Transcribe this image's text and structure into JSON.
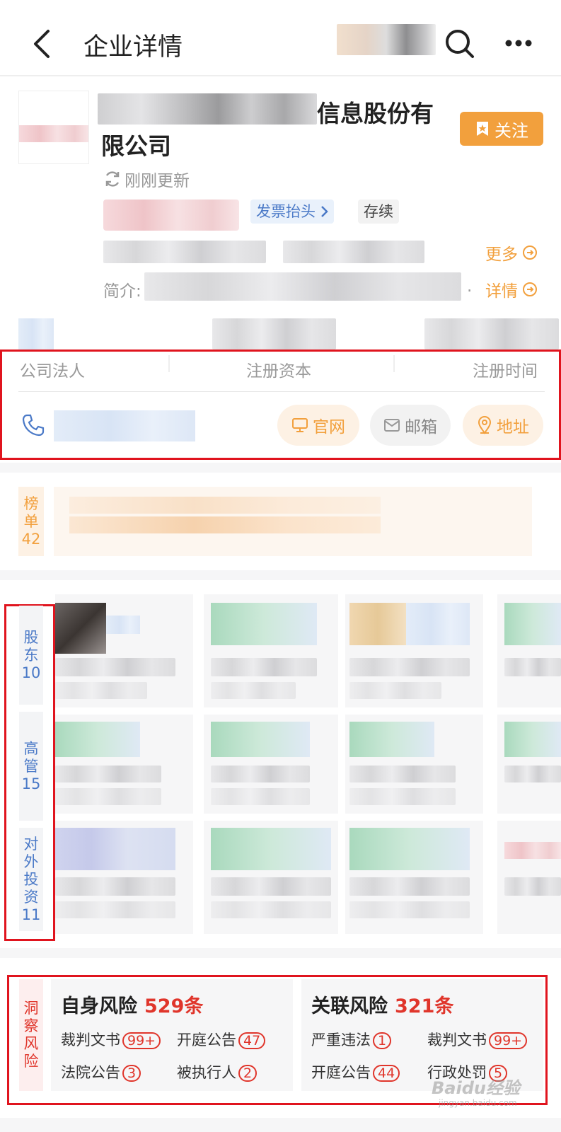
{
  "header": {
    "title": "企业详情"
  },
  "company": {
    "name_suffix": "信息股份有",
    "name_line2": "限公司",
    "follow_label": "关注",
    "updated": "刚刚更新",
    "invoice_label": "发票抬头",
    "status": "存续",
    "more_label": "更多",
    "intro_label": "简介:",
    "intro_end": ".",
    "detail_label": "详情"
  },
  "info": {
    "legal_person": "公司法人",
    "capital": "注册资本",
    "reg_time": "注册时间",
    "website": "官网",
    "email": "邮箱",
    "address": "地址"
  },
  "ranking": {
    "label_1": "榜",
    "label_2": "单",
    "count": "42"
  },
  "tabs": [
    {
      "l1": "股",
      "l2": "东",
      "count": "10"
    },
    {
      "l1": "高",
      "l2": "管",
      "count": "15"
    },
    {
      "l1": "对",
      "l2": "外",
      "l3": "投",
      "l4": "资",
      "count": "11"
    }
  ],
  "risk": {
    "label": [
      "洞",
      "察",
      "风",
      "险"
    ],
    "self": {
      "title": "自身风险",
      "count": "529条",
      "items": [
        {
          "name": "裁判文书",
          "num": "99+"
        },
        {
          "name": "开庭公告",
          "num": "47"
        },
        {
          "name": "法院公告",
          "num": "3"
        },
        {
          "name": "被执行人",
          "num": "2"
        }
      ]
    },
    "related": {
      "title": "关联风险",
      "count": "321条",
      "items": [
        {
          "name": "严重违法",
          "num": "1"
        },
        {
          "name": "裁判文书",
          "num": "99+"
        },
        {
          "name": "开庭公告",
          "num": "44"
        },
        {
          "name": "行政处罚",
          "num": "5"
        }
      ]
    }
  },
  "watermark": {
    "text": "Baidu经验",
    "sub": "jingyan.baidu.com"
  },
  "colors": {
    "accent_orange": "#f2a03d",
    "link_blue": "#4a79c7",
    "risk_red": "#e0352b",
    "highlight_red": "#e0141e"
  }
}
